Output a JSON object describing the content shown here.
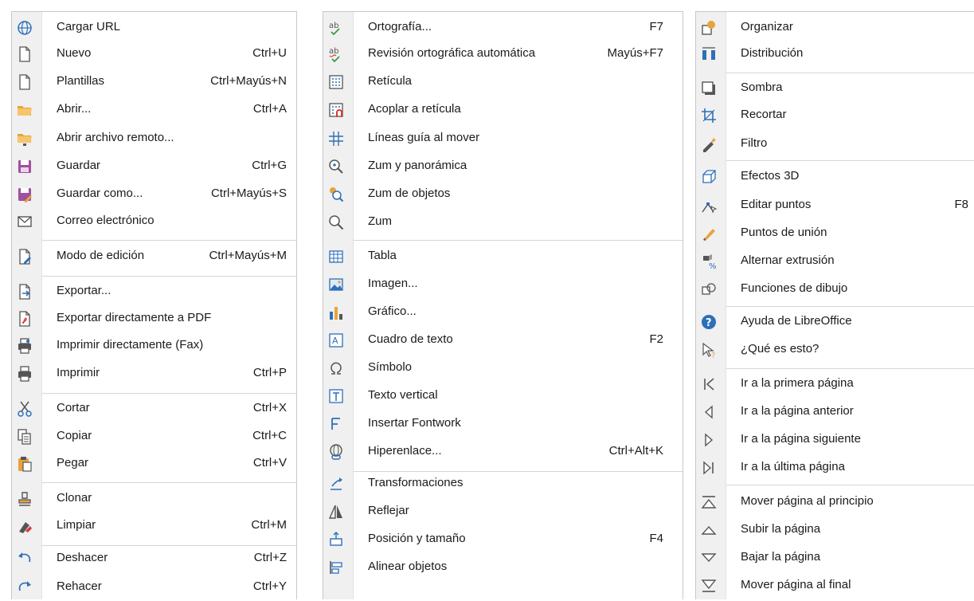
{
  "column1": {
    "items": [
      {
        "label": "Cargar URL",
        "shortcut": "",
        "icon": "globe-icon"
      },
      {
        "label": "Nuevo",
        "shortcut": "Ctrl+U",
        "icon": "new-document-icon"
      },
      {
        "label": "Plantillas",
        "shortcut": "Ctrl+Mayús+N",
        "icon": "template-icon"
      },
      {
        "label": "Abrir...",
        "shortcut": "Ctrl+A",
        "icon": "open-folder-icon"
      },
      {
        "label": "Abrir archivo remoto...",
        "shortcut": "",
        "icon": "remote-folder-icon"
      },
      {
        "label": "Guardar",
        "shortcut": "Ctrl+G",
        "icon": "save-icon"
      },
      {
        "label": "Guardar como...",
        "shortcut": "Ctrl+Mayús+S",
        "icon": "save-as-icon"
      },
      {
        "label": "Correo electrónico",
        "shortcut": "",
        "icon": "email-icon"
      },
      {
        "label": "Modo de edición",
        "shortcut": "Ctrl+Mayús+M",
        "icon": "edit-mode-icon"
      },
      {
        "label": "Exportar...",
        "shortcut": "",
        "icon": "export-icon"
      },
      {
        "label": "Exportar directamente a PDF",
        "shortcut": "",
        "icon": "export-pdf-icon"
      },
      {
        "label": "Imprimir directamente (Fax)",
        "shortcut": "",
        "icon": "fax-icon"
      },
      {
        "label": "Imprimir",
        "shortcut": "Ctrl+P",
        "icon": "print-icon"
      },
      {
        "label": "Cortar",
        "shortcut": "Ctrl+X",
        "icon": "cut-icon"
      },
      {
        "label": "Copiar",
        "shortcut": "Ctrl+C",
        "icon": "copy-icon"
      },
      {
        "label": "Pegar",
        "shortcut": "Ctrl+V",
        "icon": "paste-icon"
      },
      {
        "label": "Clonar",
        "shortcut": "",
        "icon": "clone-icon"
      },
      {
        "label": "Limpiar",
        "shortcut": "Ctrl+M",
        "icon": "clear-icon"
      },
      {
        "label": "Deshacer",
        "shortcut": "Ctrl+Z",
        "icon": "undo-icon"
      },
      {
        "label": "Rehacer",
        "shortcut": "Ctrl+Y",
        "icon": "redo-icon"
      }
    ]
  },
  "column2": {
    "items": [
      {
        "label": "Ortografía...",
        "shortcut": "F7",
        "icon": "spelling-icon"
      },
      {
        "label": "Revisión ortográfica automática",
        "shortcut": "Mayús+F7",
        "icon": "auto-spellcheck-icon"
      },
      {
        "label": "Retícula",
        "shortcut": "",
        "icon": "grid-icon"
      },
      {
        "label": "Acoplar a retícula",
        "shortcut": "",
        "icon": "snap-to-grid-icon"
      },
      {
        "label": "Líneas guía al mover",
        "shortcut": "",
        "icon": "guide-lines-icon"
      },
      {
        "label": "Zum y panorámica",
        "shortcut": "",
        "icon": "zoom-pan-icon"
      },
      {
        "label": "Zum de objetos",
        "shortcut": "",
        "icon": "zoom-objects-icon"
      },
      {
        "label": "Zum",
        "shortcut": "",
        "icon": "zoom-icon"
      },
      {
        "label": "Tabla",
        "shortcut": "",
        "icon": "table-icon"
      },
      {
        "label": "Imagen...",
        "shortcut": "",
        "icon": "image-icon"
      },
      {
        "label": "Gráfico...",
        "shortcut": "",
        "icon": "chart-icon"
      },
      {
        "label": "Cuadro de texto",
        "shortcut": "F2",
        "icon": "text-box-icon"
      },
      {
        "label": "Símbolo",
        "shortcut": "",
        "icon": "omega-symbol-icon"
      },
      {
        "label": "Texto vertical",
        "shortcut": "",
        "icon": "vertical-text-icon"
      },
      {
        "label": "Insertar Fontwork",
        "shortcut": "",
        "icon": "fontwork-icon"
      },
      {
        "label": "Hiperenlace...",
        "shortcut": "Ctrl+Alt+K",
        "icon": "hyperlink-icon"
      },
      {
        "label": "Transformaciones",
        "shortcut": "",
        "icon": "transform-icon"
      },
      {
        "label": "Reflejar",
        "shortcut": "",
        "icon": "mirror-icon"
      },
      {
        "label": "Posición y tamaño",
        "shortcut": "F4",
        "icon": "position-size-icon"
      },
      {
        "label": "Alinear objetos",
        "shortcut": "",
        "icon": "align-objects-icon"
      }
    ]
  },
  "column3": {
    "items": [
      {
        "label": "Organizar",
        "shortcut": "",
        "icon": "arrange-icon"
      },
      {
        "label": "Distribución",
        "shortcut": "",
        "icon": "distribute-icon"
      },
      {
        "label": "Sombra",
        "shortcut": "",
        "icon": "shadow-icon"
      },
      {
        "label": "Recortar",
        "shortcut": "",
        "icon": "crop-icon"
      },
      {
        "label": "Filtro",
        "shortcut": "",
        "icon": "filter-icon"
      },
      {
        "label": "Efectos 3D",
        "shortcut": "",
        "icon": "3d-effects-icon"
      },
      {
        "label": "Editar puntos",
        "shortcut": "F8",
        "icon": "edit-points-icon"
      },
      {
        "label": "Puntos de unión",
        "shortcut": "",
        "icon": "glue-points-icon"
      },
      {
        "label": "Alternar extrusión",
        "shortcut": "",
        "icon": "extrusion-icon"
      },
      {
        "label": "Funciones de dibujo",
        "shortcut": "",
        "icon": "draw-functions-icon"
      },
      {
        "label": "Ayuda de LibreOffice",
        "shortcut": "",
        "icon": "help-icon"
      },
      {
        "label": "¿Qué es esto?",
        "shortcut": "",
        "icon": "whats-this-icon"
      },
      {
        "label": "Ir a la primera página",
        "shortcut": "",
        "icon": "first-page-icon"
      },
      {
        "label": "Ir a la página anterior",
        "shortcut": "",
        "icon": "previous-page-icon"
      },
      {
        "label": "Ir a la página siguiente",
        "shortcut": "",
        "icon": "next-page-icon"
      },
      {
        "label": "Ir a la última página",
        "shortcut": "",
        "icon": "last-page-icon"
      },
      {
        "label": "Mover página al principio",
        "shortcut": "",
        "icon": "move-page-first-icon"
      },
      {
        "label": "Subir la página",
        "shortcut": "",
        "icon": "move-page-up-icon"
      },
      {
        "label": "Bajar la página",
        "shortcut": "",
        "icon": "move-page-down-icon"
      },
      {
        "label": "Mover página al final",
        "shortcut": "",
        "icon": "move-page-last-icon"
      }
    ]
  },
  "colors": {
    "icon_blue": "#2d6fb8",
    "icon_orange": "#e8a33d",
    "icon_purple": "#a14fa0",
    "icon_red": "#d9383a",
    "icon_green": "#3a9a45",
    "icon_gray": "#555555"
  }
}
